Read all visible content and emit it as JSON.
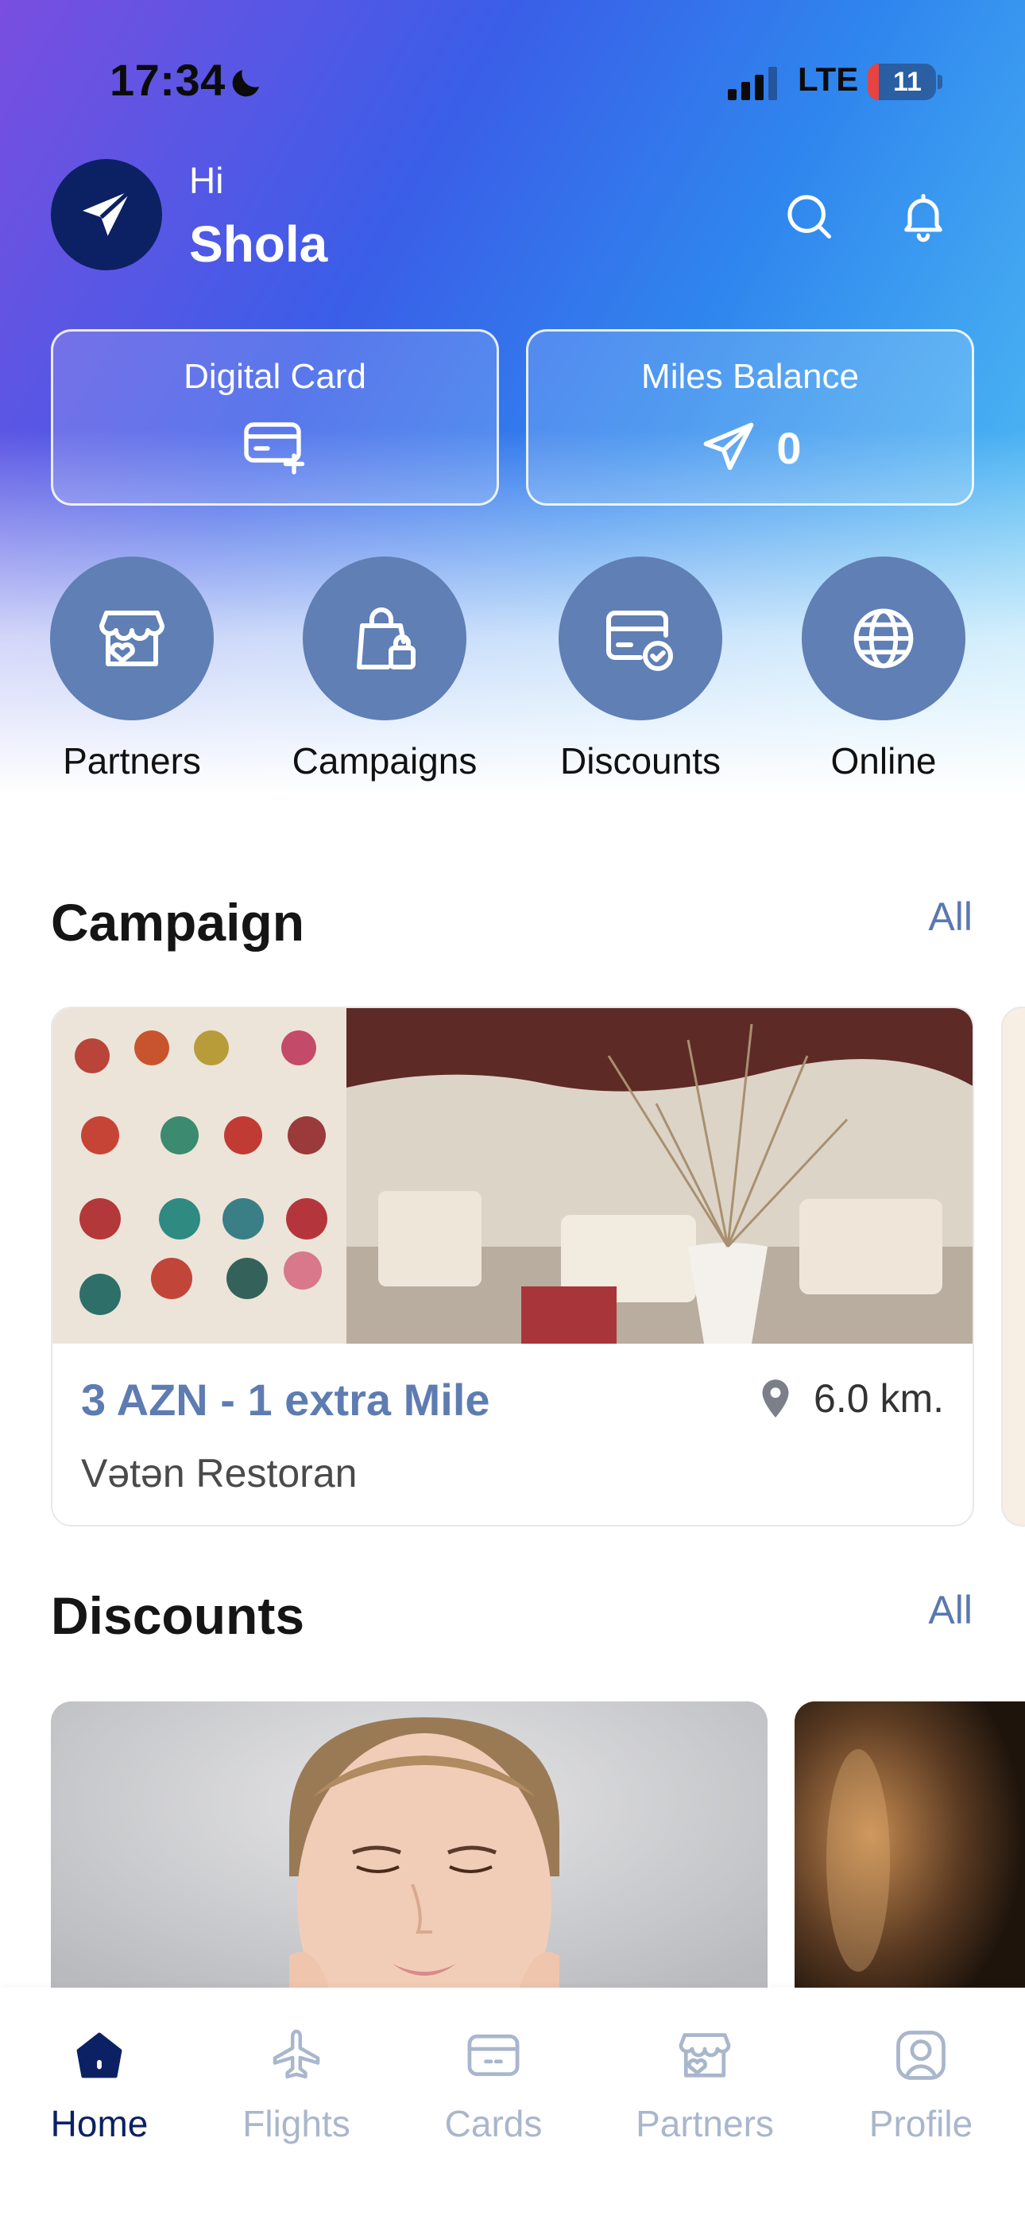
{
  "status_bar": {
    "time": "17:34",
    "network": "LTE",
    "battery": "11"
  },
  "header": {
    "greeting": "Hi",
    "user_name": "Shola",
    "avatar_icon": "paper-plane-logo-icon",
    "search_icon": "search-icon",
    "notifications_icon": "bell-icon"
  },
  "cards": {
    "digital_card": {
      "title": "Digital Card",
      "icon": "add-card-icon"
    },
    "miles_balance": {
      "title": "Miles Balance",
      "icon": "miles-logo-icon",
      "value": "0"
    }
  },
  "quick_actions": [
    {
      "label": "Partners",
      "icon": "storefront-heart-icon"
    },
    {
      "label": "Campaigns",
      "icon": "shopping-bag-icon"
    },
    {
      "label": "Discounts",
      "icon": "card-check-icon"
    },
    {
      "label": "Online",
      "icon": "globe-icon"
    }
  ],
  "campaign_section": {
    "title": "Campaign",
    "see_all": "All",
    "items": [
      {
        "headline": "3 AZN - 1 extra Mile",
        "place": "Vətən Restoran",
        "distance": "6.0 km.",
        "image": "restaurant-interior-photo"
      }
    ]
  },
  "discounts_section": {
    "title": "Discounts",
    "see_all": "All",
    "items": [
      {
        "image": "beauty-woman-face-photo"
      },
      {
        "image": "blurred-warm-photo"
      }
    ]
  },
  "tab_bar": {
    "items": [
      {
        "label": "Home",
        "icon": "home-icon",
        "active": true
      },
      {
        "label": "Flights",
        "icon": "airplane-icon",
        "active": false
      },
      {
        "label": "Cards",
        "icon": "card-icon",
        "active": false
      },
      {
        "label": "Partners",
        "icon": "storefront-heart-icon",
        "active": false
      },
      {
        "label": "Profile",
        "icon": "user-icon",
        "active": false
      }
    ]
  },
  "colors": {
    "accent": "#5f7fb5",
    "brand_dark": "#0c2163",
    "link": "#5a78b0",
    "inactive_tab": "#a9b6cc"
  }
}
